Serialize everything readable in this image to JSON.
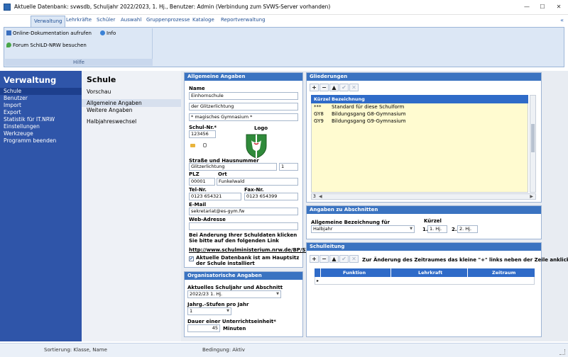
{
  "window": {
    "title": "Aktuelle Datenbank: svwsdb, Schuljahr 2022/2023, 1. Hj., Benutzer: Admin (Verbindung zum SVWS-Server vorhanden)",
    "controls": [
      "—",
      "☐",
      "✕"
    ]
  },
  "ribbon": {
    "tabs": [
      "Verwaltung",
      "Lehrkräfte",
      "Schüler",
      "Auswahl",
      "Gruppenprozesse",
      "Kataloge",
      "Reportverwaltung"
    ],
    "collapse_glyph": "«",
    "buttons": {
      "online_doc": "Online-Dokumentation aufrufen",
      "info": "Info",
      "forum": "Forum SchILD-NRW besuchen"
    },
    "group_label": "Hilfe"
  },
  "leftnav": {
    "title": "Verwaltung",
    "items": [
      "Schule",
      "Benutzer",
      "Import",
      "Export",
      "Statistik für IT.NRW",
      "Einstellungen",
      "Werkzeuge",
      "Programm beenden"
    ]
  },
  "subnav": {
    "title": "Schule",
    "items": [
      "Vorschau",
      "Allgemeine Angaben",
      "Weitere Angaben",
      "Halbjahreswechsel"
    ]
  },
  "allgemein": {
    "header": "Allgemeine Angaben",
    "name_label": "Name",
    "name_lines": [
      "Einhornschule",
      "der Glitzerlichtung",
      "* magisches Gymnasium *"
    ],
    "schulnr_label": "Schul-Nr.*",
    "schulnr_value": "123456",
    "logo_label": "Logo",
    "strasse_label": "Straße und Hausnummer",
    "strasse_value": "Glitzerlichtung",
    "hausnr_value": "1",
    "plz_label": "PLZ",
    "plz_value": "00001",
    "ort_label": "Ort",
    "ort_value": "Funkelwald",
    "tel_label": "Tel-Nr.",
    "tel_value": "0123 654321",
    "fax_label": "Fax-Nr.",
    "fax_value": "0123 654399",
    "email_label": "E-Mail",
    "email_value": "sekretariat@es-gym.fw",
    "web_label": "Web-Adresse",
    "web_value": "",
    "hint_text": "Bei Änderung Ihrer Schuldaten klicken Sie bitte auf den folgenden Link",
    "link_text": "http://www.schulministerium.nrw.de/BP/SVW",
    "checkbox_label": "Aktuelle Datenbank ist am Hauptsitz der Schule installiert"
  },
  "organisatorisch": {
    "header": "Organisatorische Angaben",
    "sj_label": "Aktuelles Schuljahr und Abschnitt",
    "sj_value": "2022/23 1. Hj.",
    "stufen_label": "Jahrg.-Stufen pro Jahr",
    "stufen_value": "1",
    "dauer_label": "Dauer einer Unterrichtseinheit*",
    "dauer_value": "45",
    "dauer_unit": "Minuten"
  },
  "gliederungen": {
    "header": "Gliederungen",
    "col_kuerzel": "Kürzel",
    "col_bezeichnung": "Bezeichnung",
    "rows": [
      {
        "kuerzel": "***",
        "bezeichnung": "Standard für diese Schulform"
      },
      {
        "kuerzel": "GY8",
        "bezeichnung": "Bildungsgang G8-Gymnasium"
      },
      {
        "kuerzel": "GY9",
        "bezeichnung": "Bildungsgang G9-Gymnasium"
      }
    ],
    "page_indicator": "3"
  },
  "abschnitte": {
    "header": "Angaben zu Abschnitten",
    "bez_label": "Allgemeine Bezeichnung für",
    "bez_value": "Halbjahr",
    "kuerzel_label": "Kürzel",
    "hj1_label": "1.",
    "hj1_value": "1. Hj.",
    "hj2_label": "2.",
    "hj2_value": "2. Hj."
  },
  "schulleitung": {
    "header": "Schulleitung",
    "hint": "Zur Änderung des Zeitraumes das kleine \"+\" links neben der Zeile anklicken",
    "col_funktion": "Funktion",
    "col_lehrkraft": "Lehrkraft",
    "col_zeitraum": "Zeitraum"
  },
  "statusbar": {
    "sortierung": "Sortierung: Klasse, Name",
    "bedingung": "Bedingung: Aktiv"
  },
  "colors": {
    "nav_bg": "#2f55a9",
    "panel_header": "#3a73c1",
    "grid_header": "#2f6bc8",
    "grid_row": "#fffbd0"
  }
}
